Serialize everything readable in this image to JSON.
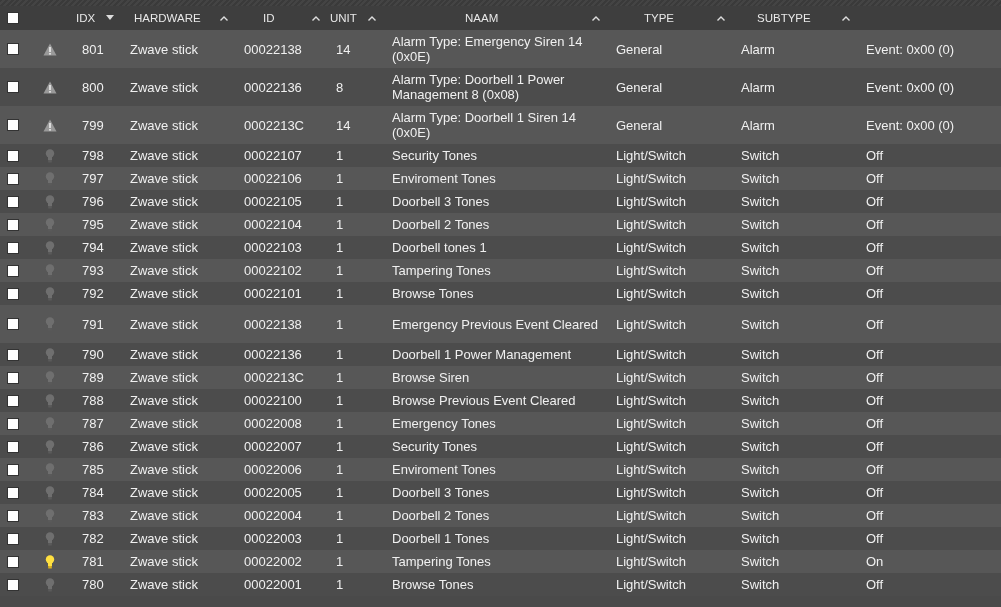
{
  "header": {
    "checked": false,
    "columns": [
      {
        "label": "IDX",
        "sorted": true
      },
      {
        "label": "HARDWARE",
        "sorted": false
      },
      {
        "label": "ID",
        "sorted": false
      },
      {
        "label": "UNIT",
        "sorted": false
      },
      {
        "label": "NAAM",
        "sorted": false
      },
      {
        "label": "TYPE",
        "sorted": false
      },
      {
        "label": "SUBTYPE",
        "sorted": false
      }
    ]
  },
  "rows": [
    {
      "checked": false,
      "kind": "alert",
      "idx": "801",
      "hardware": "Zwave stick",
      "id": "00022138",
      "unit": "14",
      "name": "Alarm Type: Emergency Siren 14 (0x0E)",
      "type": "General",
      "subtype": "Alarm",
      "data": "Event: 0x00 (0)"
    },
    {
      "checked": false,
      "kind": "alert",
      "idx": "800",
      "hardware": "Zwave stick",
      "id": "00022136",
      "unit": "8",
      "name": "Alarm Type: Doorbell 1 Power Management 8 (0x08)",
      "type": "General",
      "subtype": "Alarm",
      "data": "Event: 0x00 (0)"
    },
    {
      "checked": false,
      "kind": "alert",
      "idx": "799",
      "hardware": "Zwave stick",
      "id": "0002213C",
      "unit": "14",
      "name": "Alarm Type: Doorbell 1 Siren 14 (0x0E)",
      "type": "General",
      "subtype": "Alarm",
      "data": "Event: 0x00 (0)"
    },
    {
      "checked": false,
      "kind": "bulb",
      "on": false,
      "idx": "798",
      "hardware": "Zwave stick",
      "id": "00022107",
      "unit": "1",
      "name": "Security Tones",
      "type": "Light/Switch",
      "subtype": "Switch",
      "data": "Off"
    },
    {
      "checked": false,
      "kind": "bulb",
      "on": false,
      "idx": "797",
      "hardware": "Zwave stick",
      "id": "00022106",
      "unit": "1",
      "name": "Enviroment Tones",
      "type": "Light/Switch",
      "subtype": "Switch",
      "data": "Off"
    },
    {
      "checked": false,
      "kind": "bulb",
      "on": false,
      "idx": "796",
      "hardware": "Zwave stick",
      "id": "00022105",
      "unit": "1",
      "name": "Doorbell 3 Tones",
      "type": "Light/Switch",
      "subtype": "Switch",
      "data": "Off"
    },
    {
      "checked": false,
      "kind": "bulb",
      "on": false,
      "idx": "795",
      "hardware": "Zwave stick",
      "id": "00022104",
      "unit": "1",
      "name": "Doorbell 2 Tones",
      "type": "Light/Switch",
      "subtype": "Switch",
      "data": "Off"
    },
    {
      "checked": false,
      "kind": "bulb",
      "on": false,
      "idx": "794",
      "hardware": "Zwave stick",
      "id": "00022103",
      "unit": "1",
      "name": "Doorbell tones 1",
      "type": "Light/Switch",
      "subtype": "Switch",
      "data": "Off"
    },
    {
      "checked": false,
      "kind": "bulb",
      "on": false,
      "idx": "793",
      "hardware": "Zwave stick",
      "id": "00022102",
      "unit": "1",
      "name": "Tampering Tones",
      "type": "Light/Switch",
      "subtype": "Switch",
      "data": "Off"
    },
    {
      "checked": false,
      "kind": "bulb",
      "on": false,
      "idx": "792",
      "hardware": "Zwave stick",
      "id": "00022101",
      "unit": "1",
      "name": "Browse Tones",
      "type": "Light/Switch",
      "subtype": "Switch",
      "data": "Off"
    },
    {
      "checked": false,
      "kind": "bulb",
      "on": false,
      "idx": "791",
      "hardware": "Zwave stick",
      "id": "00022138",
      "unit": "1",
      "name": "Emergency Previous Event Cleared",
      "type": "Light/Switch",
      "subtype": "Switch",
      "data": "Off"
    },
    {
      "checked": false,
      "kind": "bulb",
      "on": false,
      "idx": "790",
      "hardware": "Zwave stick",
      "id": "00022136",
      "unit": "1",
      "name": "Doorbell 1 Power Management",
      "type": "Light/Switch",
      "subtype": "Switch",
      "data": "Off"
    },
    {
      "checked": false,
      "kind": "bulb",
      "on": false,
      "idx": "789",
      "hardware": "Zwave stick",
      "id": "0002213C",
      "unit": "1",
      "name": "Browse Siren",
      "type": "Light/Switch",
      "subtype": "Switch",
      "data": "Off"
    },
    {
      "checked": false,
      "kind": "bulb",
      "on": false,
      "idx": "788",
      "hardware": "Zwave stick",
      "id": "00022100",
      "unit": "1",
      "name": "Browse Previous Event Cleared",
      "type": "Light/Switch",
      "subtype": "Switch",
      "data": "Off"
    },
    {
      "checked": false,
      "kind": "bulb",
      "on": false,
      "idx": "787",
      "hardware": "Zwave stick",
      "id": "00022008",
      "unit": "1",
      "name": "Emergency Tones",
      "type": "Light/Switch",
      "subtype": "Switch",
      "data": "Off"
    },
    {
      "checked": false,
      "kind": "bulb",
      "on": false,
      "idx": "786",
      "hardware": "Zwave stick",
      "id": "00022007",
      "unit": "1",
      "name": "Security Tones",
      "type": "Light/Switch",
      "subtype": "Switch",
      "data": "Off"
    },
    {
      "checked": false,
      "kind": "bulb",
      "on": false,
      "idx": "785",
      "hardware": "Zwave stick",
      "id": "00022006",
      "unit": "1",
      "name": "Enviroment Tones",
      "type": "Light/Switch",
      "subtype": "Switch",
      "data": "Off"
    },
    {
      "checked": false,
      "kind": "bulb",
      "on": false,
      "idx": "784",
      "hardware": "Zwave stick",
      "id": "00022005",
      "unit": "1",
      "name": "Doorbell 3 Tones",
      "type": "Light/Switch",
      "subtype": "Switch",
      "data": "Off"
    },
    {
      "checked": false,
      "kind": "bulb",
      "on": false,
      "idx": "783",
      "hardware": "Zwave stick",
      "id": "00022004",
      "unit": "1",
      "name": "Doorbell 2 Tones",
      "type": "Light/Switch",
      "subtype": "Switch",
      "data": "Off"
    },
    {
      "checked": false,
      "kind": "bulb",
      "on": false,
      "idx": "782",
      "hardware": "Zwave stick",
      "id": "00022003",
      "unit": "1",
      "name": "Doorbell 1 Tones",
      "type": "Light/Switch",
      "subtype": "Switch",
      "data": "Off"
    },
    {
      "checked": false,
      "kind": "bulb",
      "on": true,
      "idx": "781",
      "hardware": "Zwave stick",
      "id": "00022002",
      "unit": "1",
      "name": "Tampering Tones",
      "type": "Light/Switch",
      "subtype": "Switch",
      "data": "On"
    },
    {
      "checked": false,
      "kind": "bulb",
      "on": false,
      "idx": "780",
      "hardware": "Zwave stick",
      "id": "00022001",
      "unit": "1",
      "name": "Browse Tones",
      "type": "Light/Switch",
      "subtype": "Switch",
      "data": "Off"
    }
  ]
}
